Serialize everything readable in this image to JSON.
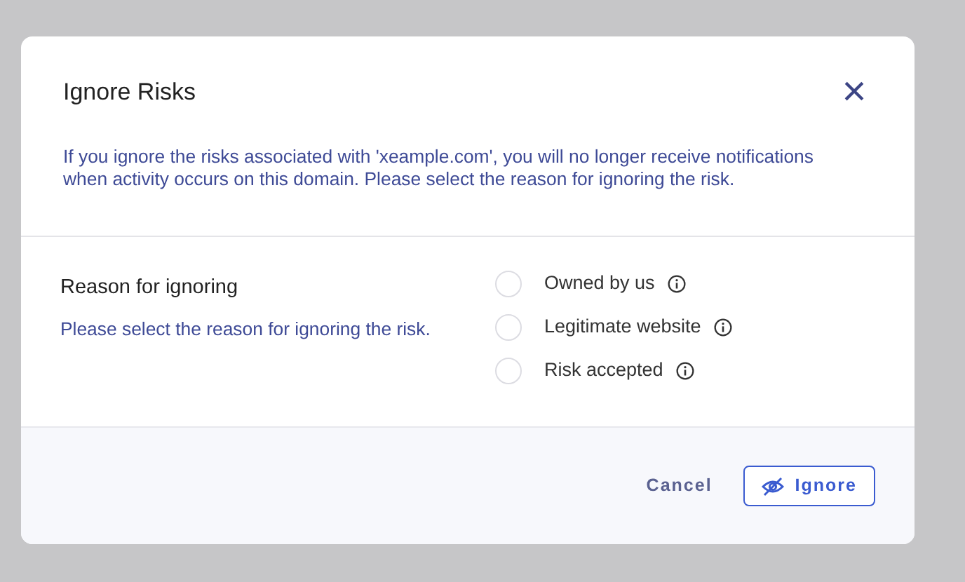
{
  "dialog": {
    "title": "Ignore Risks",
    "close": "×",
    "description": "If you ignore the risks associated with 'xeample.com', you will no longer receive notifications when activity occurs on this domain. Please select the reason for ignoring the risk.",
    "reason": {
      "label": "Reason for ignoring",
      "hint": "Please select the reason for ignoring the risk.",
      "options": [
        {
          "label": "Owned by us",
          "selected": false
        },
        {
          "label": "Legitimate website",
          "selected": false
        },
        {
          "label": "Risk accepted",
          "selected": false
        }
      ]
    },
    "buttons": [
      {
        "label": "Cancel",
        "kind": "link"
      },
      {
        "label": "Ignore",
        "kind": "outline"
      }
    ]
  }
}
